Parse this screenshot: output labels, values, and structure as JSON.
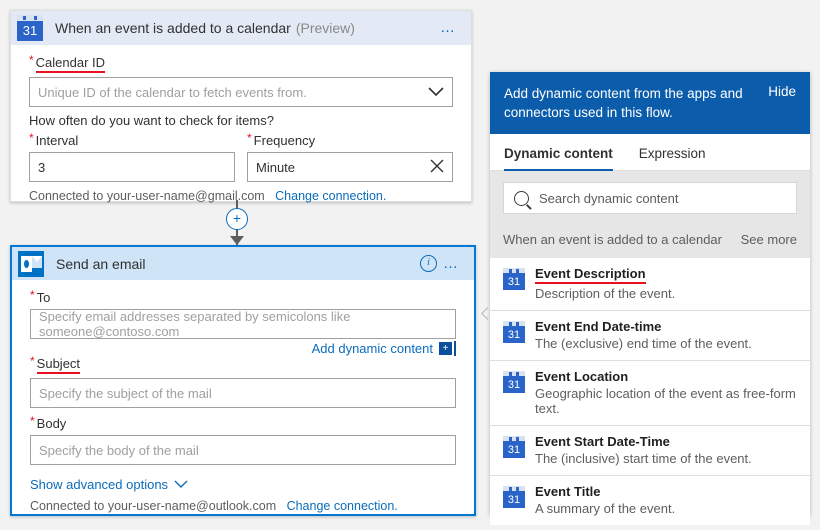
{
  "trigger_card": {
    "icon": "calendar-31-icon",
    "title": "When an event is added to a calendar",
    "preview_tag": "(Preview)",
    "more_menu": "…",
    "calendar_id": {
      "required_mark": "*",
      "label": "Calendar ID",
      "placeholder": "Unique ID of the calendar to fetch events from.",
      "chevron": "⌄"
    },
    "question": "How often do you want to check for items?",
    "interval": {
      "required_mark": "*",
      "label": "Interval",
      "value": "3"
    },
    "frequency": {
      "required_mark": "*",
      "label": "Frequency",
      "value": "Minute",
      "clear_icon": "✕"
    },
    "connection_text": "Connected to your-user-name@gmail.com",
    "change_connection": "Change connection."
  },
  "connector": {
    "plus_label": "+"
  },
  "action_card": {
    "icon": "outlook-icon",
    "title": "Send an email",
    "info_icon": "i",
    "more_menu": "…",
    "to": {
      "required_mark": "*",
      "label": "To",
      "placeholder": "Specify email addresses separated by semicolons like someone@contoso.com"
    },
    "add_dynamic_content": "Add dynamic content",
    "add_dynamic_badge": "+",
    "subject": {
      "required_mark": "*",
      "label": "Subject",
      "placeholder": "Specify the subject of the mail"
    },
    "body": {
      "required_mark": "*",
      "label": "Body",
      "placeholder": "Specify the body of the mail"
    },
    "show_advanced": "Show advanced options",
    "show_advanced_chevron": "⌄",
    "connection_text": "Connected to your-user-name@outlook.com",
    "change_connection": "Change connection."
  },
  "dynamic_panel": {
    "header_text": "Add dynamic content from the apps and connectors used in this flow.",
    "hide_label": "Hide",
    "tabs": [
      {
        "label": "Dynamic content",
        "active": true
      },
      {
        "label": "Expression",
        "active": false
      }
    ],
    "search": {
      "placeholder": "Search dynamic content",
      "icon": "search-icon"
    },
    "group": {
      "name": "When an event is added to a calendar",
      "see_more": "See more"
    },
    "items": [
      {
        "icon": "calendar-31-icon",
        "name": "Event Description",
        "desc": "Description of the event.",
        "highlighted": true
      },
      {
        "icon": "calendar-31-icon",
        "name": "Event End Date-time",
        "desc": "The (exclusive) end time of the event.",
        "highlighted": false
      },
      {
        "icon": "calendar-31-icon",
        "name": "Event Location",
        "desc": "Geographic location of the event as free-form text.",
        "highlighted": false
      },
      {
        "icon": "calendar-31-icon",
        "name": "Event Start Date-Time",
        "desc": "The (inclusive) start time of the event.",
        "highlighted": false
      },
      {
        "icon": "calendar-31-icon",
        "name": "Event Title",
        "desc": "A summary of the event.",
        "highlighted": false
      }
    ]
  },
  "colors": {
    "accent_blue": "#0b5cab",
    "link_blue": "#0b6cbb",
    "required_red": "#e81123",
    "trigger_header_bg": "#e3eaf5",
    "action_header_bg": "#cfe4f7",
    "action_border": "#0078d4",
    "calendar_icon_blue": "#2a64c8",
    "outlook_icon_blue": "#0072c6",
    "page_bg": "#f2f2f2"
  }
}
